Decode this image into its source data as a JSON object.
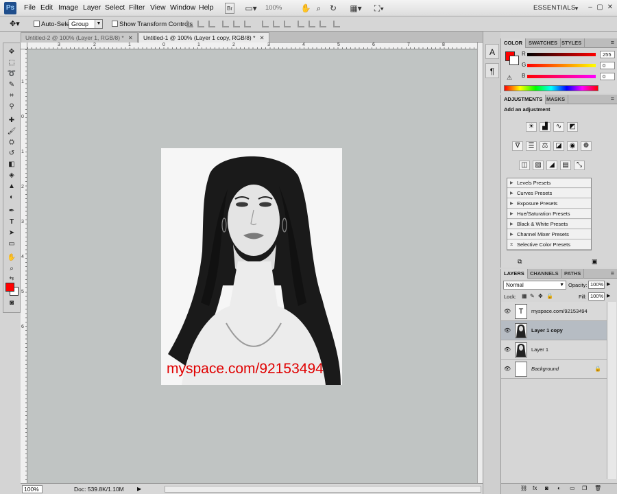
{
  "app": {
    "logo": "Ps",
    "menu": [
      "File",
      "Edit",
      "Image",
      "Layer",
      "Select",
      "Filter",
      "View",
      "Window",
      "Help"
    ],
    "zoom": "100%",
    "workspace": "ESSENTIALS"
  },
  "options_bar": {
    "auto_select_label": "Auto-Select:",
    "auto_select_value": "Group",
    "transform_label": "Show Transform Controls"
  },
  "tabs": [
    {
      "label": "Untitled-2 @ 100% (Layer 1, RGB/8) *",
      "active": false
    },
    {
      "label": "Untitled-1 @ 100% (Layer 1 copy, RGB/8) *",
      "active": true
    }
  ],
  "rulers": {
    "h_labels": [
      "3",
      "2",
      "1",
      "0",
      "1",
      "2",
      "3",
      "4",
      "5",
      "6",
      "7",
      "8"
    ],
    "v_labels": [
      "1",
      "0",
      "1",
      "2",
      "3",
      "4",
      "5",
      "6"
    ]
  },
  "canvas": {
    "watermark": "myspace.com/92153494",
    "watermark_color": "#e00000"
  },
  "status": {
    "zoom": "100%",
    "doc_info": "Doc: 539.8K/1.10M"
  },
  "color_panel": {
    "tabs": [
      "COLOR",
      "SWATCHES",
      "STYLES"
    ],
    "r_label": "R",
    "r_value": "255",
    "g_label": "G",
    "g_value": "0",
    "b_label": "B",
    "b_value": "0",
    "foreground": "#ff0000"
  },
  "adjustments_panel": {
    "tabs": [
      "ADJUSTMENTS",
      "MASKS"
    ],
    "heading": "Add an adjustment",
    "presets": [
      "Levels Presets",
      "Curves Presets",
      "Exposure Presets",
      "Hue/Saturation Presets",
      "Black & White Presets",
      "Channel Mixer Presets",
      "Selective Color Presets"
    ]
  },
  "layers_panel": {
    "tabs": [
      "LAYERS",
      "CHANNELS",
      "PATHS"
    ],
    "blend_mode": "Normal",
    "opacity_label": "Opacity:",
    "opacity_value": "100%",
    "lock_label": "Lock:",
    "fill_label": "Fill:",
    "fill_value": "100%",
    "layers": [
      {
        "name": "myspace.com/92153494",
        "thumb": "T",
        "selected": false
      },
      {
        "name": "Layer 1 copy",
        "thumb": "",
        "selected": true
      },
      {
        "name": "Layer 1",
        "thumb": "",
        "selected": false
      },
      {
        "name": "Background",
        "thumb": "",
        "selected": false
      }
    ]
  }
}
